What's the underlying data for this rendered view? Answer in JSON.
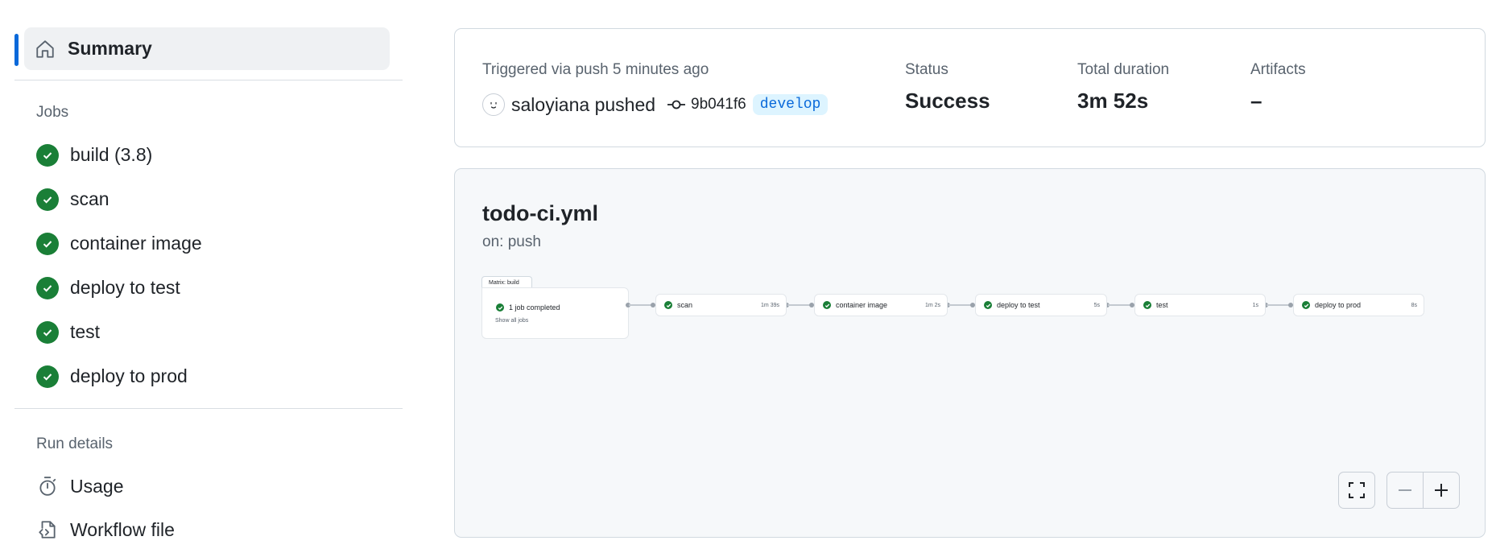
{
  "sidebar": {
    "summary_label": "Summary",
    "jobs_heading": "Jobs",
    "jobs": [
      {
        "label": "build (3.8)"
      },
      {
        "label": "scan"
      },
      {
        "label": "container image"
      },
      {
        "label": "deploy to test"
      },
      {
        "label": "test"
      },
      {
        "label": "deploy to prod"
      }
    ],
    "run_details_heading": "Run details",
    "run_items": [
      {
        "label": "Usage",
        "icon": "stopwatch-icon"
      },
      {
        "label": "Workflow file",
        "icon": "file-code-icon"
      }
    ]
  },
  "summary": {
    "triggered": "Triggered via push 5 minutes ago",
    "actor_text": "saloyiana pushed",
    "commit": "9b041f6",
    "branch": "develop",
    "status_label": "Status",
    "status_value": "Success",
    "duration_label": "Total duration",
    "duration_value": "3m 52s",
    "artifacts_label": "Artifacts",
    "artifacts_value": "–"
  },
  "graph": {
    "workflow_name": "todo-ci.yml",
    "trigger": "on: push",
    "matrix_tab": "Matrix: build",
    "matrix_status": "1 job completed",
    "matrix_show": "Show all jobs",
    "nodes": [
      {
        "label": "scan",
        "duration": "1m 39s"
      },
      {
        "label": "container image",
        "duration": "1m 2s"
      },
      {
        "label": "deploy to test",
        "duration": "5s"
      },
      {
        "label": "test",
        "duration": "1s"
      },
      {
        "label": "deploy to prod",
        "duration": "8s"
      }
    ]
  },
  "colors": {
    "accent": "#0969da",
    "success": "#1a7f37",
    "branch_bg": "#ddf4ff"
  }
}
